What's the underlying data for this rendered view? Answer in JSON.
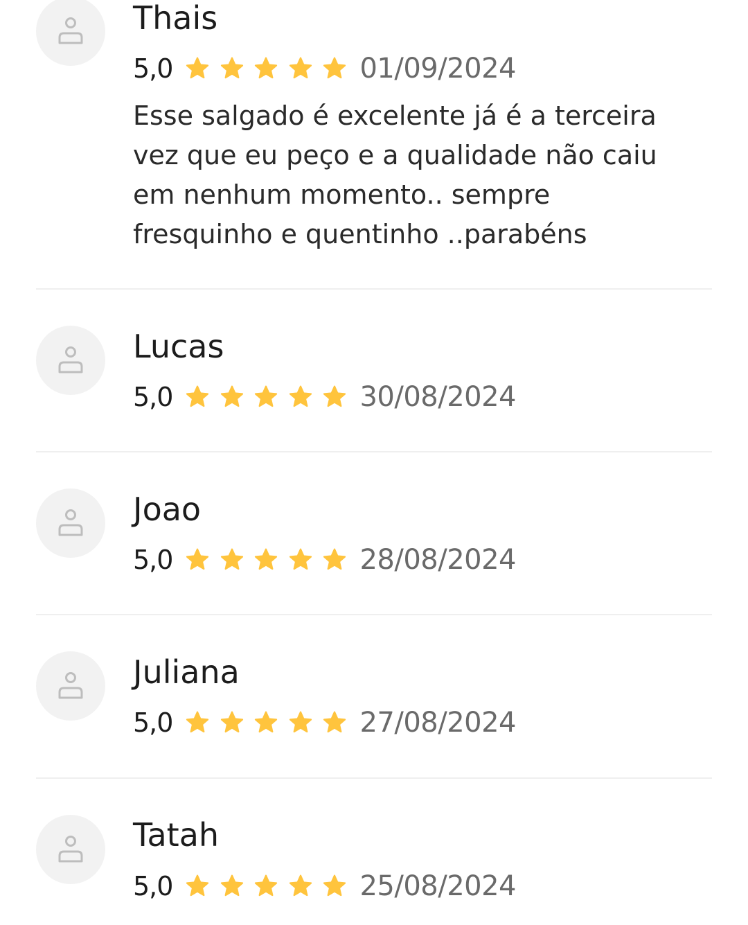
{
  "reviews": [
    {
      "name": "Thais",
      "score": "5,0",
      "date": "01/09/2024",
      "comment": "Esse salgado é excelente já é a terceira vez que eu peço e a qualidade não caiu em nenhum momento.. sempre fresquinho e quentinho ..parabéns"
    },
    {
      "name": "Lucas",
      "score": "5,0",
      "date": "30/08/2024"
    },
    {
      "name": "Joao",
      "score": "5,0",
      "date": "28/08/2024"
    },
    {
      "name": "Juliana",
      "score": "5,0",
      "date": "27/08/2024"
    },
    {
      "name": "Tatah",
      "score": "5,0",
      "date": "25/08/2024"
    }
  ],
  "star_rating": {
    "filled": 5,
    "max": 5
  },
  "colors": {
    "star": "#FFC43D",
    "avatar_bg": "#F2F2F2",
    "avatar_icon": "#BDBDBD",
    "divider": "#EFEFEF",
    "date_text": "#6A6A6A"
  },
  "icons": {
    "avatar": "user-placeholder-icon",
    "star": "star-icon"
  }
}
